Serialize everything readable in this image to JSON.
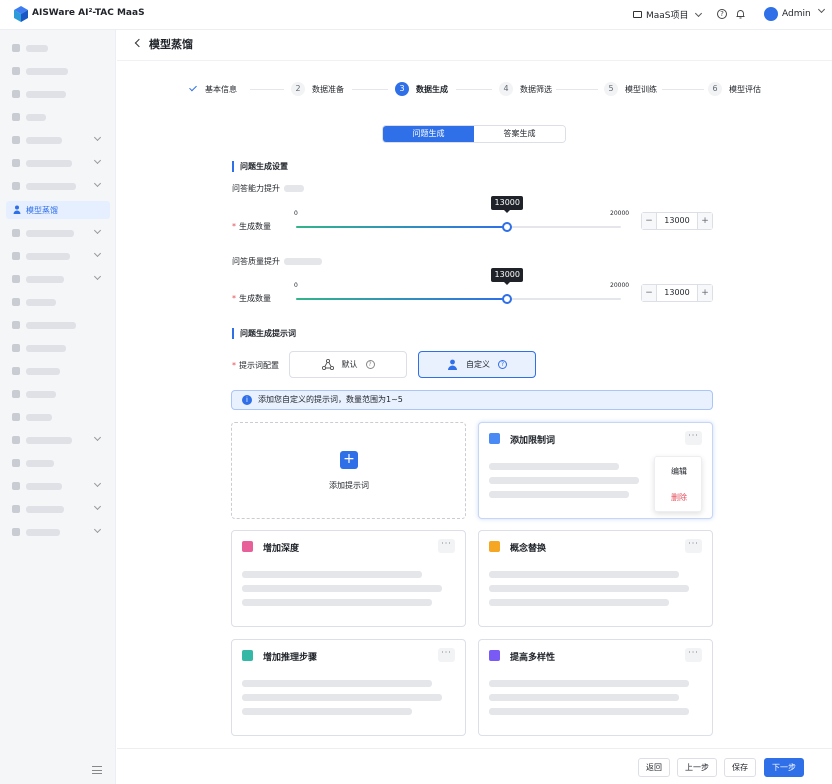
{
  "app": {
    "title": "AISWare AI²-TAC MaaS",
    "logo": "cube-logo-icon"
  },
  "header": {
    "project": "MaaS项目",
    "user": "Admin"
  },
  "sidebar": {
    "active_label": "模型蒸馏"
  },
  "page": {
    "title": "模型蒸馏"
  },
  "steps": [
    {
      "num": "✓",
      "label": "基本信息",
      "state": "done"
    },
    {
      "num": "2",
      "label": "数据准备",
      "state": "todo"
    },
    {
      "num": "3",
      "label": "数据生成",
      "state": "active"
    },
    {
      "num": "4",
      "label": "数据筛选",
      "state": "todo"
    },
    {
      "num": "5",
      "label": "模型训练",
      "state": "todo"
    },
    {
      "num": "6",
      "label": "模型评估",
      "state": "todo"
    }
  ],
  "tabs": {
    "question": "问题生成",
    "answer": "答案生成"
  },
  "settings": {
    "section_title": "问题生成设置",
    "group1_label": "问答能力提升",
    "group2_label": "问答质量提升",
    "count_label": "生成数量",
    "slider1": {
      "min": "0",
      "max": "20000",
      "value": "13000",
      "fraction": 0.65
    },
    "slider2": {
      "min": "0",
      "max": "20000",
      "value": "13000",
      "fraction": 0.65
    },
    "minus": "−",
    "plus": "+"
  },
  "prompts": {
    "section_title": "问题生成提示词",
    "config_label": "提示词配置",
    "default_label": "默认",
    "custom_label": "自定义",
    "info": "添加您自定义的提示词，数量范围为1~5",
    "add_label": "添加提示词",
    "cards": [
      {
        "title": "添加限制词",
        "color": "#4a8af4"
      },
      {
        "title": "增加深度",
        "color": "#e8609a"
      },
      {
        "title": "概念替换",
        "color": "#f5a623"
      },
      {
        "title": "增加推理步骤",
        "color": "#35b8a6"
      },
      {
        "title": "提高多样性",
        "color": "#7a5af5"
      }
    ],
    "menu": {
      "edit": "编辑",
      "delete": "删除"
    }
  },
  "footer": {
    "back": "返回",
    "prev": "上一步",
    "save": "保存",
    "next": "下一步"
  },
  "colors": {
    "primary": "#2f6fe8",
    "danger": "#e34d59"
  }
}
